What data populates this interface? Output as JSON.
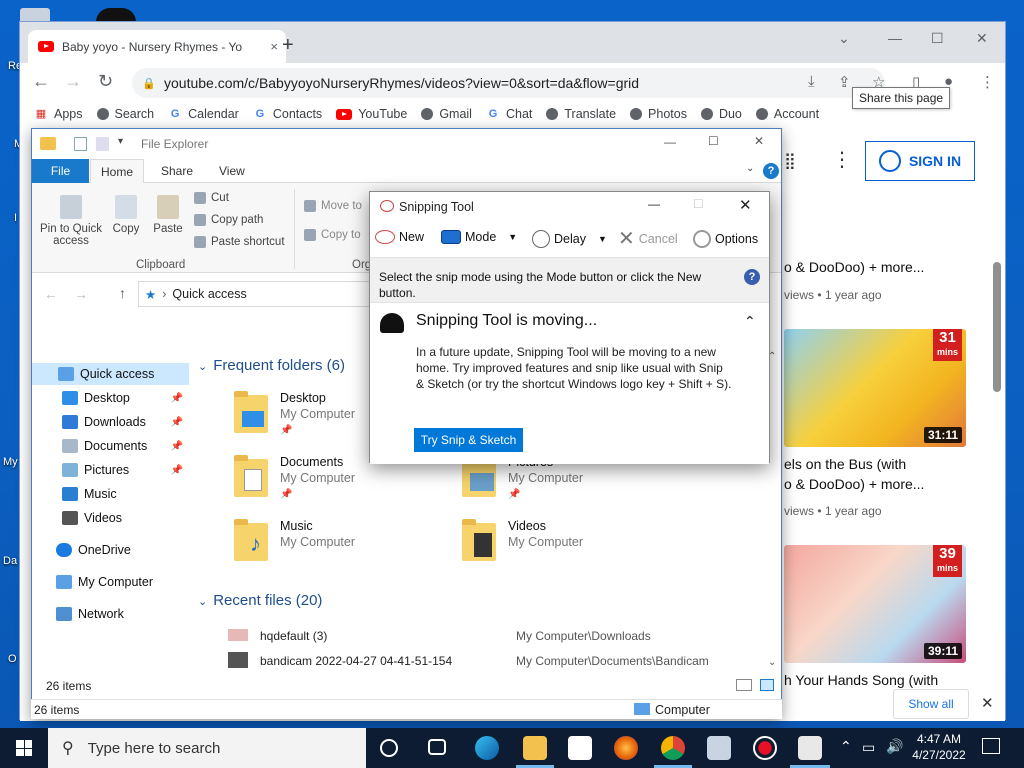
{
  "desktop": {
    "labels": [
      "Re",
      "M",
      "I",
      "My",
      "Da",
      "O"
    ]
  },
  "chrome": {
    "tab_title": "Baby yoyo - Nursery Rhymes - Yo",
    "tab_close": "×",
    "new_tab": "+",
    "url": "youtube.com/c/BabyyoyoNurseryRhymes/videos?view=0&sort=da&flow=grid",
    "tooltip": "Share this page",
    "bookmarks": [
      {
        "label": "Apps",
        "icon": "apps-grid-icon"
      },
      {
        "label": "Search",
        "icon": "globe-icon"
      },
      {
        "label": "Calendar",
        "icon": "google-icon"
      },
      {
        "label": "Contacts",
        "icon": "google-icon"
      },
      {
        "label": "YouTube",
        "icon": "youtube-icon"
      },
      {
        "label": "Gmail",
        "icon": "globe-icon"
      },
      {
        "label": "Chat",
        "icon": "google-icon"
      },
      {
        "label": "Translate",
        "icon": "globe-icon"
      },
      {
        "label": "Photos",
        "icon": "globe-icon"
      },
      {
        "label": "Duo",
        "icon": "globe-icon"
      },
      {
        "label": "Account",
        "icon": "globe-icon"
      }
    ]
  },
  "youtube": {
    "sign_in": "SIGN IN",
    "videos": [
      {
        "title_line": "o & DooDoo) + more...",
        "meta": "views • 1 year ago"
      },
      {
        "title_line1": "els on the Bus (with",
        "title_line2": "o & DooDoo) + more...",
        "meta": "views • 1 year ago",
        "duration": "31:11",
        "mins": "31",
        "mins_label": "mins"
      },
      {
        "title_line1": "h Your Hands Song (with",
        "duration": "39:11",
        "mins": "39",
        "mins_label": "mins"
      }
    ],
    "show_all": "Show all"
  },
  "explorer": {
    "title": "File Explorer",
    "tabs": [
      "File",
      "Home",
      "Share",
      "View"
    ],
    "ribbon": {
      "pin_label": "Pin to Quick access",
      "copy": "Copy",
      "paste": "Paste",
      "cut": "Cut",
      "copy_path": "Copy path",
      "paste_shortcut": "Paste shortcut",
      "clipboard": "Clipboard",
      "move_to": "Move to",
      "copy_to": "Copy to",
      "organize_partial": "Org"
    },
    "address": "Quick access",
    "nav": [
      {
        "label": "Quick access",
        "selected": true
      },
      {
        "label": "Desktop",
        "pinned": true
      },
      {
        "label": "Downloads",
        "pinned": true
      },
      {
        "label": "Documents",
        "pinned": true
      },
      {
        "label": "Pictures",
        "pinned": true
      },
      {
        "label": "Music"
      },
      {
        "label": "Videos"
      },
      {
        "label": "OneDrive"
      },
      {
        "label": "My Computer"
      },
      {
        "label": "Network"
      }
    ],
    "frequent_header": "Frequent folders (6)",
    "folders": [
      {
        "name": "Desktop",
        "sub": "My Computer"
      },
      {
        "name": "Documents",
        "sub": "My Computer"
      },
      {
        "name": "Pictures",
        "sub": "My Computer"
      },
      {
        "name": "Music",
        "sub": "My Computer"
      },
      {
        "name": "Videos",
        "sub": "My Computer"
      }
    ],
    "recent_header": "Recent files (20)",
    "recent": [
      {
        "name": "hqdefault (3)",
        "path": "My Computer\\Downloads"
      },
      {
        "name": "bandicam 2022-04-27 04-41-51-154",
        "path": "My Computer\\Documents\\Bandicam"
      }
    ],
    "items_count": "26 items",
    "status_left": "26 items",
    "status_right": "Computer"
  },
  "snipping": {
    "title": "Snipping Tool",
    "new": "New",
    "mode": "Mode",
    "delay": "Delay",
    "cancel": "Cancel",
    "options": "Options",
    "instruction": "Select the snip mode using the Mode button or click the New button.",
    "panel_title": "Snipping Tool is moving...",
    "panel_body": "In a future update, Snipping Tool will be moving to a new home. Try improved features and snip like usual with Snip & Sketch (or try the shortcut Windows logo key + Shift + S).",
    "cta": "Try Snip & Sketch"
  },
  "taskbar": {
    "search_placeholder": "Type here to search",
    "time": "4:47 AM",
    "date": "4/27/2022"
  }
}
